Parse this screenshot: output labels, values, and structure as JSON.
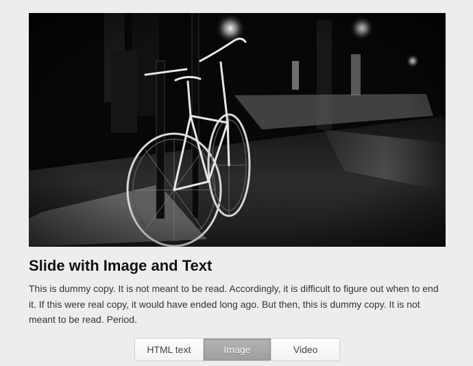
{
  "slide": {
    "title": "Slide with Image and Text",
    "body": "This is dummy copy. It is not meant to be read. Accordingly, it is difficult to figure out when to end it. If this were real copy, it would have ended long ago. But then, this is dummy copy. It is not meant to be read. Period.",
    "image": "black-and-white photo of a bicycle leaning on a post on a city sidewalk at night"
  },
  "tabs": {
    "active": "Image",
    "items": [
      {
        "label": "HTML text"
      },
      {
        "label": "Image"
      },
      {
        "label": "Video"
      }
    ]
  },
  "colors": {
    "page_background": "#ededed",
    "active_tab": "#a8a8a8",
    "title": "#111111",
    "body_text": "#333333"
  }
}
